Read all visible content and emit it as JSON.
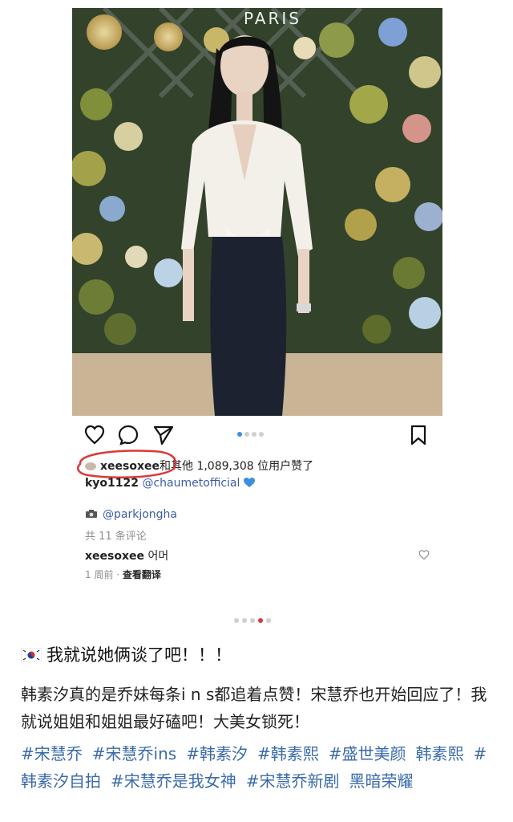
{
  "photo": {
    "sign_text": "PARIS"
  },
  "icons": {
    "heart": "heart-icon",
    "comment": "comment-icon",
    "share": "send-icon",
    "bookmark": "bookmark-icon"
  },
  "carousel": {
    "count": 4,
    "active": 0
  },
  "likes": {
    "username": "xeesoxee",
    "text_a": "和",
    "text_b": "其他 1,089,308 位用户赞了"
  },
  "caption": {
    "username": "kyo1122",
    "mention": "@chaumetofficial"
  },
  "tag": {
    "handle": "@parkjongha"
  },
  "comments": {
    "count_text": "共 11 条评论",
    "first": {
      "user": "xeesoxee",
      "text": "어머"
    },
    "meta_time": "1 周前",
    "meta_sep": " · ",
    "meta_translate": "查看翻译"
  },
  "pager": {
    "count": 5,
    "active": 3
  },
  "post": {
    "title": "我就说她俩谈了吧！！！",
    "body": "韩素汐真的是乔妹每条i n s都追着点赞！宋慧乔也开始回应了！我就说姐姐和姐姐最好磕吧！大美女锁死！",
    "hashtags": [
      "#宋慧乔",
      "#宋慧乔ins",
      "#韩素汐",
      "#韩素熙",
      "#盛世美颜",
      "韩素熙",
      "#韩素汐自拍",
      "#宋慧乔是我女神",
      "#宋慧乔新剧",
      "黑暗荣耀"
    ]
  },
  "colors": {
    "link": "#3a5da8",
    "hashtag": "#3a6aa8",
    "circle": "#d93a3a",
    "heart_blue": "#3b8fe0"
  }
}
